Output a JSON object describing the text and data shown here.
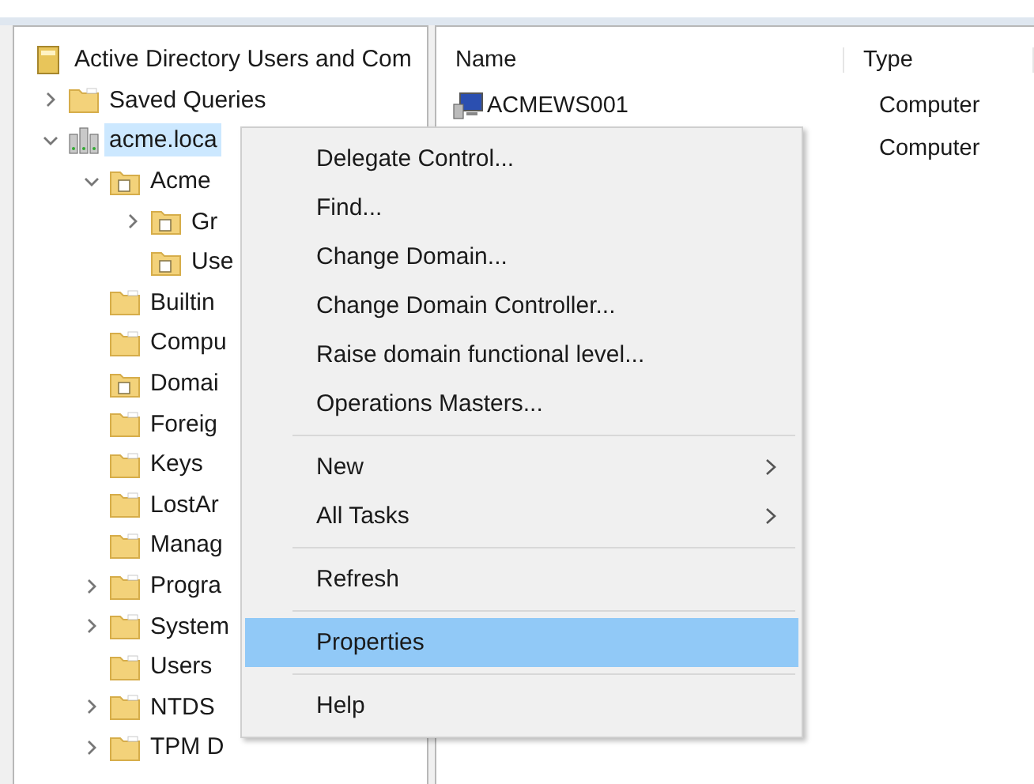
{
  "tree": {
    "label": "Active Directory Users and Com",
    "kind": "console",
    "children": [
      {
        "label": "Saved Queries",
        "kind": "folder",
        "expanded": false
      },
      {
        "label": "acme.loca",
        "kind": "domain",
        "expanded": true,
        "selected": true,
        "children": [
          {
            "label": "Acme",
            "kind": "ou",
            "expanded": true,
            "children": [
              {
                "label": "Gr",
                "kind": "ou",
                "expanded": false
              },
              {
                "label": "Use",
                "kind": "ou"
              }
            ]
          },
          {
            "label": "Builtin",
            "kind": "folder"
          },
          {
            "label": "Compu",
            "kind": "folder"
          },
          {
            "label": "Domai",
            "kind": "ou"
          },
          {
            "label": "Foreig",
            "kind": "folder"
          },
          {
            "label": "Keys",
            "kind": "folder"
          },
          {
            "label": "LostAr",
            "kind": "folder"
          },
          {
            "label": "Manag",
            "kind": "folder"
          },
          {
            "label": "Progra",
            "kind": "folder",
            "expanded": false
          },
          {
            "label": "System",
            "kind": "folder",
            "expanded": false
          },
          {
            "label": "Users",
            "kind": "folder"
          },
          {
            "label": "NTDS",
            "kind": "folder",
            "expanded": false
          },
          {
            "label": "TPM D",
            "kind": "folder",
            "expanded": false
          }
        ]
      }
    ]
  },
  "list": {
    "columns": [
      "Name",
      "Type"
    ],
    "rows": [
      {
        "name": "ACMEWS001",
        "type": "Computer"
      },
      {
        "type": "Computer"
      }
    ]
  },
  "context_menu": [
    {
      "kind": "item",
      "label": "Delegate Control...",
      "selected": false
    },
    {
      "kind": "item",
      "label": "Find...",
      "selected": false
    },
    {
      "kind": "item",
      "label": "Change Domain...",
      "selected": false
    },
    {
      "kind": "item",
      "label": "Change Domain Controller...",
      "selected": false
    },
    {
      "kind": "item",
      "label": "Raise domain functional level...",
      "selected": false
    },
    {
      "kind": "item",
      "label": "Operations Masters...",
      "selected": false
    },
    {
      "kind": "separator"
    },
    {
      "kind": "submenu",
      "label": "New",
      "selected": false
    },
    {
      "kind": "submenu",
      "label": "All Tasks",
      "selected": false
    },
    {
      "kind": "separator"
    },
    {
      "kind": "item",
      "label": "Refresh",
      "selected": false
    },
    {
      "kind": "separator"
    },
    {
      "kind": "item",
      "label": "Properties",
      "selected": true
    },
    {
      "kind": "separator"
    },
    {
      "kind": "item",
      "label": "Help",
      "selected": false
    }
  ]
}
